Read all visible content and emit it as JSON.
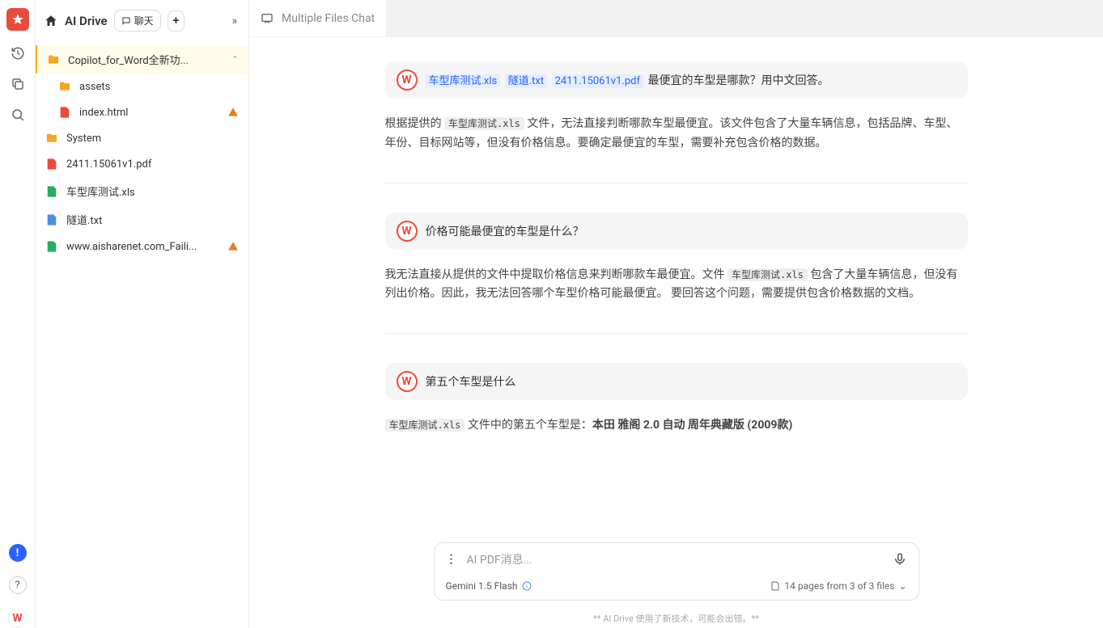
{
  "app": {
    "title": "AI Drive"
  },
  "header_chips": {
    "chat": "聊天",
    "plus": "+",
    "more": "»"
  },
  "tree": {
    "folder1": "Copilot_for_Word全新功...",
    "child1": "assets",
    "child2": "index.html",
    "item_system": "System",
    "item_pdf": "2411.15061v1.pdf",
    "item_xls": "车型库测试.xls",
    "item_txt": "隧道.txt",
    "item_xls2": "www.aisharenet.com_Faili..."
  },
  "tab": {
    "name": "Multiple Files Chat"
  },
  "messages": {
    "u1": {
      "files": [
        "车型库测试.xls",
        "隧道.txt",
        "2411.15061v1.pdf"
      ],
      "text": "最便宜的车型是哪款？用中文回答。"
    },
    "a1": {
      "pre": "根据提供的 ",
      "code": "车型库测试.xls",
      "post": " 文件，无法直接判断哪款车型最便宜。该文件包含了大量车辆信息，包括品牌、车型、年份、目标网站等，但没有价格信息。要确定最便宜的车型，需要补充包含价格的数据。"
    },
    "u2": {
      "text": "价格可能最便宜的车型是什么？"
    },
    "a2": {
      "pre": "我无法直接从提供的文件中提取价格信息来判断哪款车最便宜。文件 ",
      "code": "车型库测试.xls",
      "post": " 包含了大量车辆信息，但没有列出价格。因此，我无法回答哪个车型价格可能最便宜。 要回答这个问题，需要提供包含价格数据的文档。"
    },
    "u3": {
      "text": "第五个车型是什么"
    },
    "a3": {
      "code": "车型库测试.xls",
      "mid": " 文件中的第五个车型是：",
      "bold": "本田 雅阁 2.0 自动 周年典藏版 (2009款)"
    }
  },
  "input": {
    "placeholder": "AI PDF消息...",
    "model": "Gemini 1.5 Flash",
    "pages": "14 pages from 3 of 3 files"
  },
  "footer": "** AI Drive 使用了新技术，可能会出错。**"
}
